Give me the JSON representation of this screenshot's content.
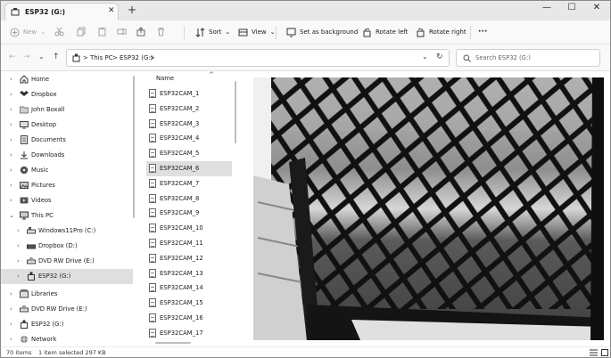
{
  "window": {
    "tab_title": "ESP32 (G:)",
    "tab_close": "✕",
    "new_tab": "+",
    "minimize": "—",
    "maximize": "☐",
    "close": "✕"
  },
  "toolbar": {
    "new_label": "New",
    "sort_label": "Sort",
    "view_label": "View",
    "set_background_label": "Set as background",
    "rotate_left_label": "Rotate left",
    "rotate_right_label": "Rotate right",
    "more_label": "···"
  },
  "address": {
    "crumb_1": "This PC",
    "crumb_2": "ESP32 (G:)",
    "separator": ">",
    "search_placeholder": "Search ESP32 (G:)"
  },
  "sidebar": {
    "items": [
      {
        "label": "Home",
        "icon": "home-icon"
      },
      {
        "label": "Dropbox",
        "icon": "dropbox-icon"
      },
      {
        "label": "John Boxall",
        "icon": "user-folder-icon"
      },
      {
        "label": "Desktop",
        "icon": "desktop-icon"
      },
      {
        "label": "Documents",
        "icon": "documents-icon"
      },
      {
        "label": "Downloads",
        "icon": "downloads-icon"
      },
      {
        "label": "Music",
        "icon": "music-icon"
      },
      {
        "label": "Pictures",
        "icon": "pictures-icon"
      },
      {
        "label": "Videos",
        "icon": "videos-icon"
      },
      {
        "label": "This PC",
        "icon": "computer-icon"
      },
      {
        "label": "Windows11Pro (C:)",
        "icon": "drive-icon"
      },
      {
        "label": "Dropbox (D:)",
        "icon": "drive-icon"
      },
      {
        "label": "DVD RW Drive (E:)",
        "icon": "dvd-icon"
      },
      {
        "label": "ESP32 (G:)",
        "icon": "usb-drive-icon"
      },
      {
        "label": "Libraries",
        "icon": "libraries-icon"
      },
      {
        "label": "DVD RW Drive (E:)",
        "icon": "dvd-icon"
      },
      {
        "label": "ESP32 (G:)",
        "icon": "usb-drive-icon"
      },
      {
        "label": "Network",
        "icon": "network-icon"
      }
    ]
  },
  "filelist": {
    "column_header": "Name",
    "sort_indicator": "^",
    "files": [
      "ESP32CAM_1",
      "ESP32CAM_2",
      "ESP32CAM_3",
      "ESP32CAM_4",
      "ESP32CAM_5",
      "ESP32CAM_6",
      "ESP32CAM_7",
      "ESP32CAM_8",
      "ESP32CAM_9",
      "ESP32CAM_10",
      "ESP32CAM_11",
      "ESP32CAM_12",
      "ESP32CAM_13",
      "ESP32CAM_14",
      "ESP32CAM_15",
      "ESP32CAM_16",
      "ESP32CAM_17"
    ],
    "selected_file": "ESP32CAM_6"
  },
  "status": {
    "item_count": "70 items",
    "selection": "1 item selected  297 KB"
  },
  "colors": {
    "selection": "#dfdfdf",
    "chrome": "#f9f9f9",
    "tab_strip": "#e8e8e8"
  }
}
